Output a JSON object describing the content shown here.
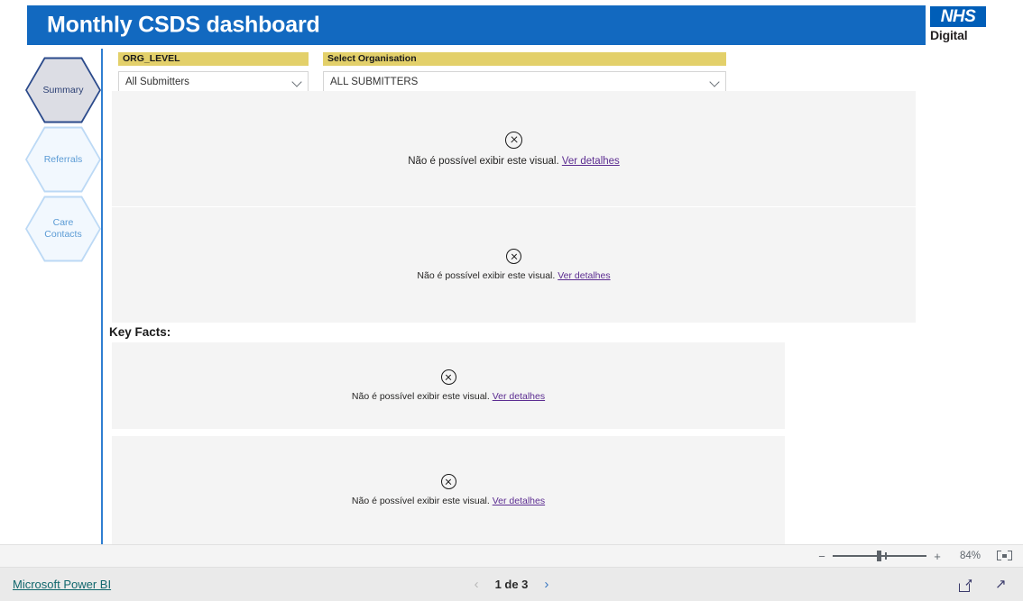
{
  "header": {
    "title": "Monthly CSDS dashboard",
    "brand_color": "#1269c0",
    "logo": {
      "mark": "NHS",
      "word": "Digital",
      "mark_color": "#005eb8"
    }
  },
  "sidebar": {
    "items": [
      {
        "label": "Summary",
        "active": true
      },
      {
        "label": "Referrals",
        "active": false
      },
      {
        "label": "Care\nContacts",
        "active": false
      }
    ]
  },
  "slicers": [
    {
      "id": "org-level",
      "header": "ORG_LEVEL",
      "value": "All Submitters",
      "header_color": "#e3d06a"
    },
    {
      "id": "select-organisation",
      "header": "Select Organisation",
      "value": "ALL SUBMITTERS",
      "header_color": "#e3d06a"
    }
  ],
  "main": {
    "key_facts_label": "Key Facts:",
    "error_visuals": [
      {
        "id": "top",
        "message": "Não é possível exibir este visual.",
        "link": "Ver detalhes"
      },
      {
        "id": "second",
        "message": "Não é possível exibir este visual.",
        "link": "Ver detalhes"
      },
      {
        "id": "keyfact1",
        "message": "Não é possível exibir este visual.",
        "link": "Ver detalhes"
      },
      {
        "id": "keyfact2",
        "message": "Não é possível exibir este visual.",
        "link": "Ver detalhes"
      }
    ],
    "error_link_color": "#5c2d91"
  },
  "zoom_bar": {
    "minus": "−",
    "plus": "+",
    "percent": "84%"
  },
  "footer": {
    "powerbi_link": "Microsoft Power BI",
    "powerbi_link_color": "#11676d",
    "prev_arrow": "‹",
    "next_arrow": "›",
    "page_label": "1 de 3"
  }
}
